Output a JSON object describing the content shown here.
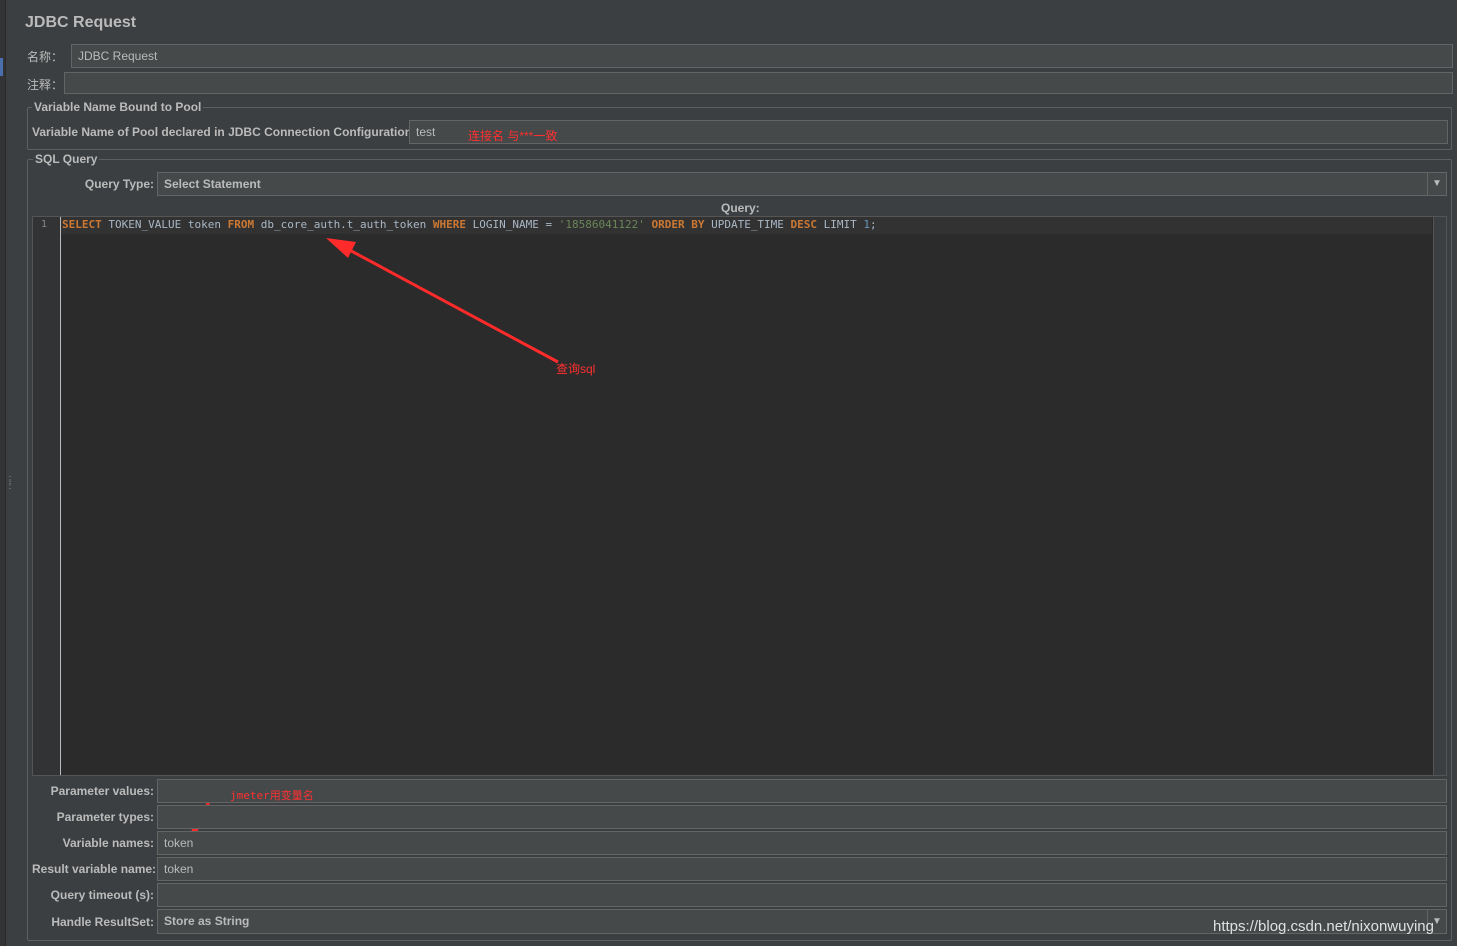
{
  "panel": {
    "title": "JDBC Request",
    "name_label": "名称：",
    "name_value": "JDBC Request",
    "comments_label": "注释："
  },
  "pool_group": {
    "title": "Variable Name Bound to Pool",
    "pool_label": "Variable Name of Pool declared in JDBC Connection Configuration:",
    "pool_value": "test",
    "annotation": "连接名 与***一致"
  },
  "sql_group": {
    "title": "SQL Query",
    "query_type_label": "Query Type:",
    "query_type_value": "Select Statement",
    "query_label": "Query:",
    "line_number": "1",
    "query_tokens": {
      "t1": "SELECT",
      "t2": " TOKEN_VALUE token ",
      "t3": "FROM",
      "t4": " db_core_auth.t_auth_token ",
      "t5": "WHERE",
      "t6": " LOGIN_NAME = ",
      "t7": "'18586041122'",
      "t8": " ",
      "t9": "ORDER BY",
      "t10": " UPDATE_TIME ",
      "t11": "DESC",
      "t12": " LIMIT ",
      "t13": "1",
      "t14": ";"
    },
    "query_annotation": "查询sql"
  },
  "params": {
    "parameter_values_label": "Parameter values:",
    "parameter_values": "",
    "parameter_types_label": "Parameter types:",
    "parameter_types": "",
    "variable_names_label": "Variable names:",
    "variable_names": "token",
    "result_variable_label": "Result variable name:",
    "result_variable": "token",
    "timeout_label": "Query timeout (s):",
    "timeout": "",
    "handle_resultset_label": "Handle ResultSet:",
    "handle_resultset": "Store as String",
    "variable_annotation": "jmeter用变量名"
  },
  "watermark": "https://blog.csdn.net/nixonwuying",
  "icons": {
    "combo_arrow": "chevron-down-icon"
  },
  "colors": {
    "background": "#3c3f41",
    "field": "#45494a",
    "editor": "#2b2b2b",
    "keyword": "#cc7832",
    "string": "#6a8759",
    "number": "#6897bb",
    "annotation": "#ff3030"
  }
}
